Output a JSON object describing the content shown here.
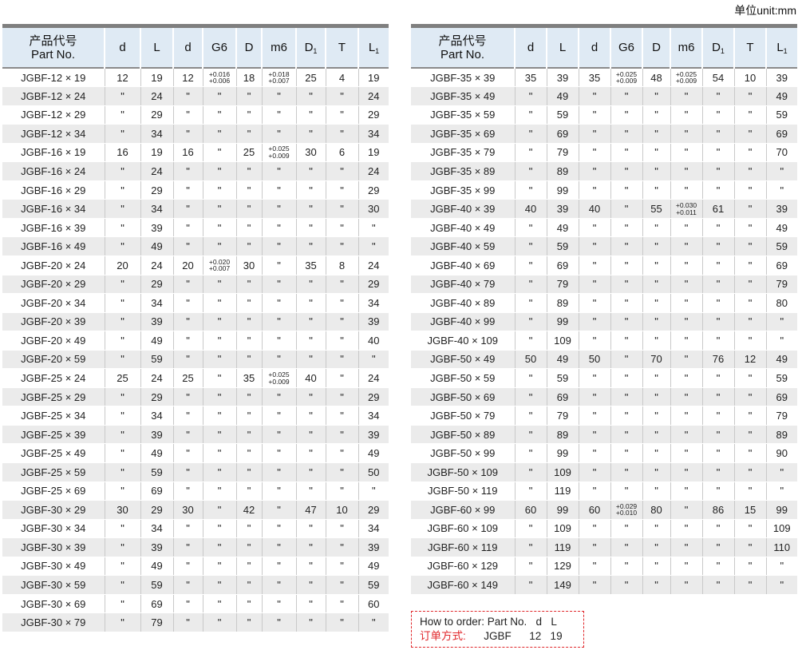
{
  "unit_label": "单位unit:mm",
  "headers": {
    "part_cn": "产品代号",
    "part_en": "Part No.",
    "d": "d",
    "L": "L",
    "d2": "d",
    "G6": "G6",
    "D": "D",
    "m6": "m6",
    "D1": "D",
    "D1_sub": "1",
    "T": "T",
    "L1": "L",
    "L1_sub": "1"
  },
  "left_table": [
    [
      "JGBF-12 × 19",
      "12",
      "19",
      "12",
      [
        "+0.016",
        "+0.006"
      ],
      "18",
      [
        "+0.018",
        "+0.007"
      ],
      "25",
      "4",
      "19"
    ],
    [
      "JGBF-12 × 24",
      "\"",
      "24",
      "\"",
      "\"",
      "\"",
      "\"",
      "\"",
      "\"",
      "24"
    ],
    [
      "JGBF-12 × 29",
      "\"",
      "29",
      "\"",
      "\"",
      "\"",
      "\"",
      "\"",
      "\"",
      "29"
    ],
    [
      "JGBF-12 × 34",
      "\"",
      "34",
      "\"",
      "\"",
      "\"",
      "\"",
      "\"",
      "\"",
      "34"
    ],
    [
      "JGBF-16 × 19",
      "16",
      "19",
      "16",
      "\"",
      "25",
      [
        "+0.025",
        "+0.009"
      ],
      "30",
      "6",
      "19"
    ],
    [
      "JGBF-16 × 24",
      "\"",
      "24",
      "\"",
      "\"",
      "\"",
      "\"",
      "\"",
      "\"",
      "24"
    ],
    [
      "JGBF-16 × 29",
      "\"",
      "29",
      "\"",
      "\"",
      "\"",
      "\"",
      "\"",
      "\"",
      "29"
    ],
    [
      "JGBF-16 × 34",
      "\"",
      "34",
      "\"",
      "\"",
      "\"",
      "\"",
      "\"",
      "\"",
      "30"
    ],
    [
      "JGBF-16 × 39",
      "\"",
      "39",
      "\"",
      "\"",
      "\"",
      "\"",
      "\"",
      "\"",
      "\""
    ],
    [
      "JGBF-16 × 49",
      "\"",
      "49",
      "\"",
      "\"",
      "\"",
      "\"",
      "\"",
      "\"",
      "\""
    ],
    [
      "JGBF-20 × 24",
      "20",
      "24",
      "20",
      [
        "+0.020",
        "+0.007"
      ],
      "30",
      "\"",
      "35",
      "8",
      "24"
    ],
    [
      "JGBF-20 × 29",
      "\"",
      "29",
      "\"",
      "\"",
      "\"",
      "\"",
      "\"",
      "\"",
      "29"
    ],
    [
      "JGBF-20 × 34",
      "\"",
      "34",
      "\"",
      "\"",
      "\"",
      "\"",
      "\"",
      "\"",
      "34"
    ],
    [
      "JGBF-20 × 39",
      "\"",
      "39",
      "\"",
      "\"",
      "\"",
      "\"",
      "\"",
      "\"",
      "39"
    ],
    [
      "JGBF-20 × 49",
      "\"",
      "49",
      "\"",
      "\"",
      "\"",
      "\"",
      "\"",
      "\"",
      "40"
    ],
    [
      "JGBF-20 × 59",
      "\"",
      "59",
      "\"",
      "\"",
      "\"",
      "\"",
      "\"",
      "\"",
      "\""
    ],
    [
      "JGBF-25 × 24",
      "25",
      "24",
      "25",
      "\"",
      "35",
      [
        "+0.025",
        "+0.009"
      ],
      "40",
      "\"",
      "24"
    ],
    [
      "JGBF-25 × 29",
      "\"",
      "29",
      "\"",
      "\"",
      "\"",
      "\"",
      "\"",
      "\"",
      "29"
    ],
    [
      "JGBF-25 × 34",
      "\"",
      "34",
      "\"",
      "\"",
      "\"",
      "\"",
      "\"",
      "\"",
      "34"
    ],
    [
      "JGBF-25 × 39",
      "\"",
      "39",
      "\"",
      "\"",
      "\"",
      "\"",
      "\"",
      "\"",
      "39"
    ],
    [
      "JGBF-25 × 49",
      "\"",
      "49",
      "\"",
      "\"",
      "\"",
      "\"",
      "\"",
      "\"",
      "49"
    ],
    [
      "JGBF-25 × 59",
      "\"",
      "59",
      "\"",
      "\"",
      "\"",
      "\"",
      "\"",
      "\"",
      "50"
    ],
    [
      "JGBF-25 × 69",
      "\"",
      "69",
      "\"",
      "\"",
      "\"",
      "\"",
      "\"",
      "\"",
      "\""
    ],
    [
      "JGBF-30 × 29",
      "30",
      "29",
      "30",
      "\"",
      "42",
      "\"",
      "47",
      "10",
      "29"
    ],
    [
      "JGBF-30 × 34",
      "\"",
      "34",
      "\"",
      "\"",
      "\"",
      "\"",
      "\"",
      "\"",
      "34"
    ],
    [
      "JGBF-30 × 39",
      "\"",
      "39",
      "\"",
      "\"",
      "\"",
      "\"",
      "\"",
      "\"",
      "39"
    ],
    [
      "JGBF-30 × 49",
      "\"",
      "49",
      "\"",
      "\"",
      "\"",
      "\"",
      "\"",
      "\"",
      "49"
    ],
    [
      "JGBF-30 × 59",
      "\"",
      "59",
      "\"",
      "\"",
      "\"",
      "\"",
      "\"",
      "\"",
      "59"
    ],
    [
      "JGBF-30 × 69",
      "\"",
      "69",
      "\"",
      "\"",
      "\"",
      "\"",
      "\"",
      "\"",
      "60"
    ],
    [
      "JGBF-30 × 79",
      "\"",
      "79",
      "\"",
      "\"",
      "\"",
      "\"",
      "\"",
      "\"",
      "\""
    ]
  ],
  "right_table": [
    [
      "JGBF-35 × 39",
      "35",
      "39",
      "35",
      [
        "+0.025",
        "+0.009"
      ],
      "48",
      [
        "+0.025",
        "+0.009"
      ],
      "54",
      "10",
      "39"
    ],
    [
      "JGBF-35 × 49",
      "\"",
      "49",
      "\"",
      "\"",
      "\"",
      "\"",
      "\"",
      "\"",
      "49"
    ],
    [
      "JGBF-35 × 59",
      "\"",
      "59",
      "\"",
      "\"",
      "\"",
      "\"",
      "\"",
      "\"",
      "59"
    ],
    [
      "JGBF-35 × 69",
      "\"",
      "69",
      "\"",
      "\"",
      "\"",
      "\"",
      "\"",
      "\"",
      "69"
    ],
    [
      "JGBF-35 × 79",
      "\"",
      "79",
      "\"",
      "\"",
      "\"",
      "\"",
      "\"",
      "\"",
      "70"
    ],
    [
      "JGBF-35 × 89",
      "\"",
      "89",
      "\"",
      "\"",
      "\"",
      "\"",
      "\"",
      "\"",
      "\""
    ],
    [
      "JGBF-35 × 99",
      "\"",
      "99",
      "\"",
      "\"",
      "\"",
      "\"",
      "\"",
      "\"",
      "\""
    ],
    [
      "JGBF-40 × 39",
      "40",
      "39",
      "40",
      "\"",
      "55",
      [
        "+0.030",
        "+0.011"
      ],
      "61",
      "\"",
      "39"
    ],
    [
      "JGBF-40 × 49",
      "\"",
      "49",
      "\"",
      "\"",
      "\"",
      "\"",
      "\"",
      "\"",
      "49"
    ],
    [
      "JGBF-40 × 59",
      "\"",
      "59",
      "\"",
      "\"",
      "\"",
      "\"",
      "\"",
      "\"",
      "59"
    ],
    [
      "JGBF-40 × 69",
      "\"",
      "69",
      "\"",
      "\"",
      "\"",
      "\"",
      "\"",
      "\"",
      "69"
    ],
    [
      "JGBF-40 × 79",
      "\"",
      "79",
      "\"",
      "\"",
      "\"",
      "\"",
      "\"",
      "\"",
      "79"
    ],
    [
      "JGBF-40 × 89",
      "\"",
      "89",
      "\"",
      "\"",
      "\"",
      "\"",
      "\"",
      "\"",
      "80"
    ],
    [
      "JGBF-40 × 99",
      "\"",
      "99",
      "\"",
      "\"",
      "\"",
      "\"",
      "\"",
      "\"",
      "\""
    ],
    [
      "JGBF-40 × 109",
      "\"",
      "109",
      "\"",
      "\"",
      "\"",
      "\"",
      "\"",
      "\"",
      "\""
    ],
    [
      "JGBF-50 × 49",
      "50",
      "49",
      "50",
      "\"",
      "70",
      "\"",
      "76",
      "12",
      "49"
    ],
    [
      "JGBF-50 × 59",
      "\"",
      "59",
      "\"",
      "\"",
      "\"",
      "\"",
      "\"",
      "\"",
      "59"
    ],
    [
      "JGBF-50 × 69",
      "\"",
      "69",
      "\"",
      "\"",
      "\"",
      "\"",
      "\"",
      "\"",
      "69"
    ],
    [
      "JGBF-50 × 79",
      "\"",
      "79",
      "\"",
      "\"",
      "\"",
      "\"",
      "\"",
      "\"",
      "79"
    ],
    [
      "JGBF-50 × 89",
      "\"",
      "89",
      "\"",
      "\"",
      "\"",
      "\"",
      "\"",
      "\"",
      "89"
    ],
    [
      "JGBF-50 × 99",
      "\"",
      "99",
      "\"",
      "\"",
      "\"",
      "\"",
      "\"",
      "\"",
      "90"
    ],
    [
      "JGBF-50 × 109",
      "\"",
      "109",
      "\"",
      "\"",
      "\"",
      "\"",
      "\"",
      "\"",
      "\""
    ],
    [
      "JGBF-50 × 119",
      "\"",
      "119",
      "\"",
      "\"",
      "\"",
      "\"",
      "\"",
      "\"",
      "\""
    ],
    [
      "JGBF-60 × 99",
      "60",
      "99",
      "60",
      [
        "+0.029",
        "+0.010"
      ],
      "80",
      "\"",
      "86",
      "15",
      "99"
    ],
    [
      "JGBF-60 × 109",
      "\"",
      "109",
      "\"",
      "\"",
      "\"",
      "\"",
      "\"",
      "\"",
      "109"
    ],
    [
      "JGBF-60 × 119",
      "\"",
      "119",
      "\"",
      "\"",
      "\"",
      "\"",
      "\"",
      "\"",
      "110"
    ],
    [
      "JGBF-60 × 129",
      "\"",
      "129",
      "\"",
      "\"",
      "\"",
      "\"",
      "\"",
      "\"",
      "\""
    ],
    [
      "JGBF-60 × 149",
      "\"",
      "149",
      "\"",
      "\"",
      "\"",
      "\"",
      "\"",
      "\"",
      "\""
    ]
  ],
  "order": {
    "line1": "How to order: Part No.   d   L",
    "line2_label": "订单方式:",
    "line2_value": "JGBF      12   19"
  }
}
